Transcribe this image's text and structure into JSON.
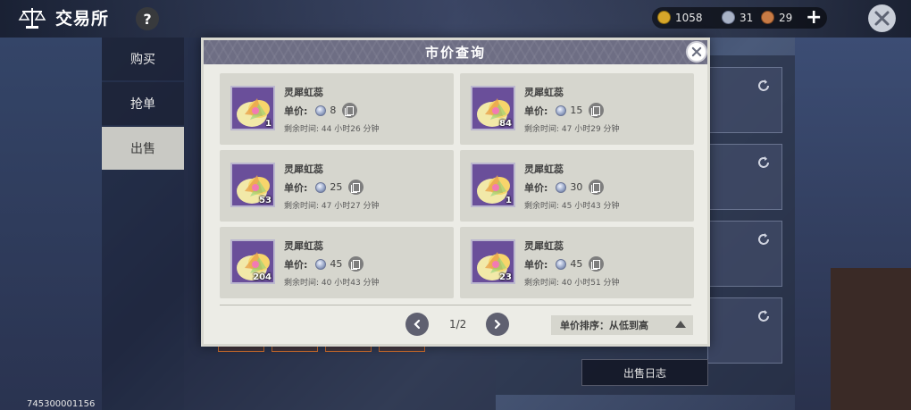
{
  "header": {
    "title": "交易所",
    "help_label": "?"
  },
  "currency": [
    {
      "name": "gold-coin",
      "value": "1058",
      "color": "#d6a62a"
    },
    {
      "name": "silver-orb",
      "value": "31",
      "color": "#a9b3c6"
    },
    {
      "name": "copper-orb",
      "value": "29",
      "color": "#c87b45"
    }
  ],
  "side_tabs": [
    {
      "label": "购买",
      "active": false
    },
    {
      "label": "抢单",
      "active": false
    },
    {
      "label": "出售",
      "active": true
    }
  ],
  "sale_log_label": "出售日志",
  "uid": "745300001156",
  "modal": {
    "title": "市价查询",
    "price_label": "单价:",
    "time_label": "剩余时间:",
    "listings": [
      {
        "name": "灵犀虹蕊",
        "qty": "1",
        "price": "8",
        "time": "44 小时26 分钟"
      },
      {
        "name": "灵犀虹蕊",
        "qty": "84",
        "price": "15",
        "time": "47 小时29 分钟"
      },
      {
        "name": "灵犀虹蕊",
        "qty": "53",
        "price": "25",
        "time": "47 小时27 分钟"
      },
      {
        "name": "灵犀虹蕊",
        "qty": "1",
        "price": "30",
        "time": "45 小时43 分钟"
      },
      {
        "name": "灵犀虹蕊",
        "qty": "204",
        "price": "45",
        "time": "40 小时43 分钟"
      },
      {
        "name": "灵犀虹蕊",
        "qty": "23",
        "price": "45",
        "time": "40 小时51 分钟"
      }
    ],
    "page": "1/2",
    "sort_label": "单价排序：从低到高"
  }
}
